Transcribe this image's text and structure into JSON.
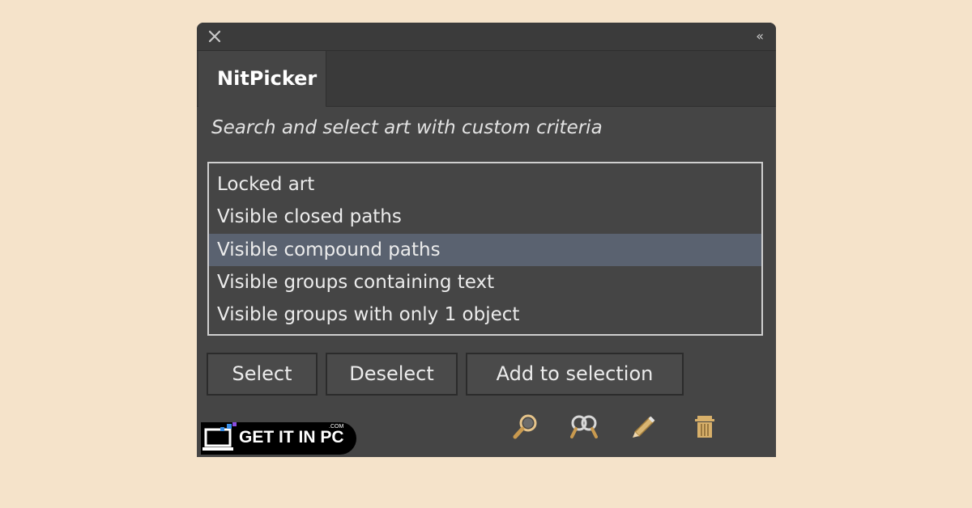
{
  "panel": {
    "title_controls": {
      "collapse": "‹‹"
    },
    "tab": {
      "label": "NitPicker"
    },
    "subtitle": "Search and select art with custom criteria",
    "criteria_list": [
      {
        "label": "Locked art",
        "selected": false
      },
      {
        "label": "Visible closed paths",
        "selected": false
      },
      {
        "label": "Visible compound paths",
        "selected": true
      },
      {
        "label": "Visible groups containing text",
        "selected": false
      },
      {
        "label": "Visible groups with only 1 object",
        "selected": false
      }
    ],
    "buttons": {
      "select": "Select",
      "deselect": "Deselect",
      "add_to_selection": "Add to selection"
    },
    "toolbar_icons": [
      "search-icon",
      "find-all-icon",
      "edit-icon",
      "trash-icon"
    ]
  },
  "watermark": {
    "text": "GET IT IN PC",
    "suffix": ".COM"
  },
  "colors": {
    "background": "#f5e3ca",
    "panel": "#454545",
    "selected_row": "#5a6270",
    "icon_gold": "#d8b06a"
  }
}
